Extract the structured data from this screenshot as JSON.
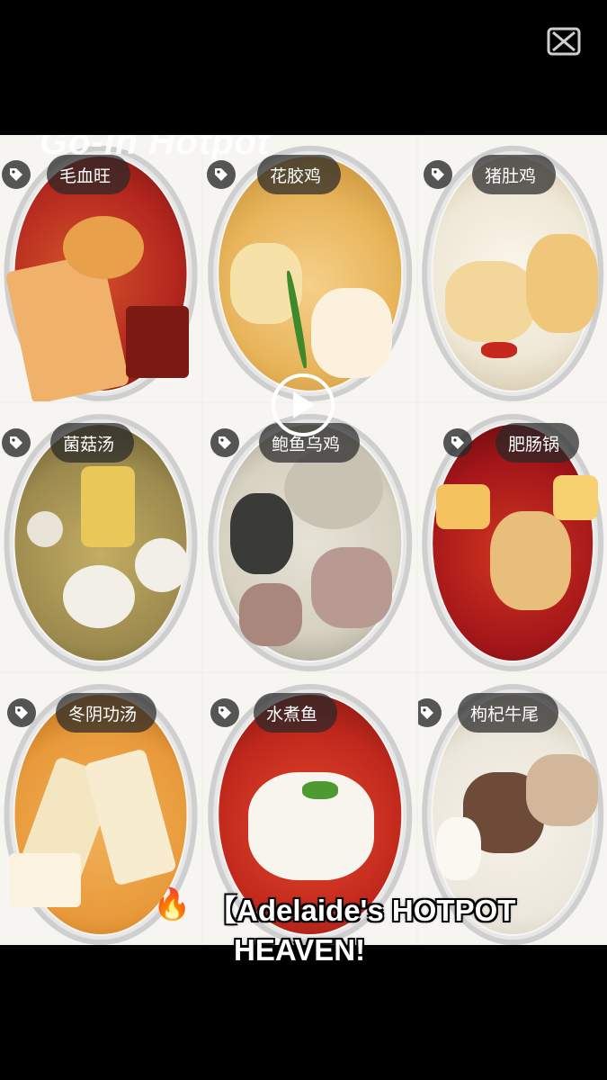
{
  "overlay": {
    "title": "Go-In Hotpot",
    "caption_line1": "【Adelaide's HOTPOT",
    "caption_line2": "HEAVEN!"
  },
  "app_logo_icon": "capcut-logo-icon",
  "play_icon": "play-icon",
  "dishes": [
    {
      "label": "毛血旺",
      "soup": "#b3261e"
    },
    {
      "label": "花胶鸡",
      "soup": "#e8b45a"
    },
    {
      "label": "猪肚鸡",
      "soup": "#efe7d6"
    },
    {
      "label": "菌菇汤",
      "soup": "#9c8a4e"
    },
    {
      "label": "鲍鱼乌鸡",
      "soup": "#d6d1c1"
    },
    {
      "label": "肥肠锅",
      "soup": "#a4161a"
    },
    {
      "label": "冬阴功汤",
      "soup": "#e89a3a"
    },
    {
      "label": "水煮鱼",
      "soup": "#c0281c"
    },
    {
      "label": "枸杞牛尾",
      "soup": "#ece7dc"
    }
  ]
}
